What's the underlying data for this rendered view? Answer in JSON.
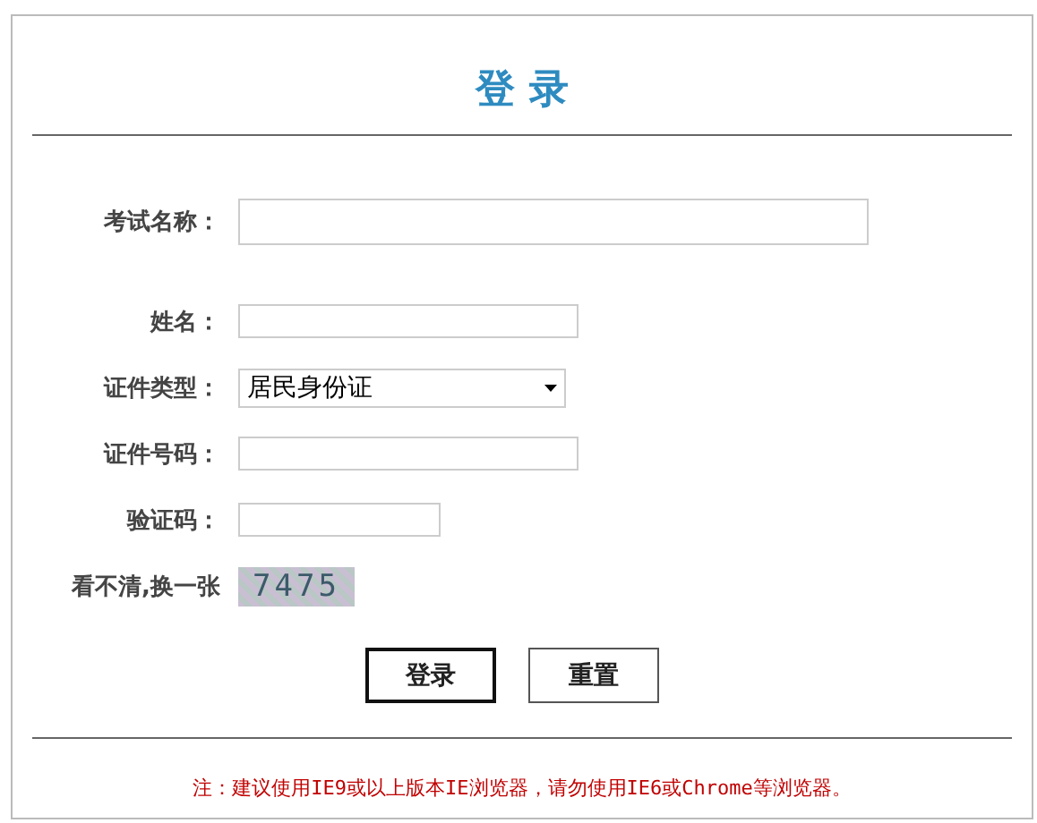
{
  "title": "登 录",
  "fields": [
    {
      "kind": "text",
      "label": "考试名称："
    },
    {
      "kind": "text",
      "label": "姓名："
    },
    {
      "kind": "select",
      "label": "证件类型：",
      "value": "居民身份证"
    },
    {
      "kind": "text",
      "label": "证件号码："
    },
    {
      "kind": "text",
      "label": "验证码："
    }
  ],
  "captcha": {
    "link": "看不清,换一张",
    "code": "7475"
  },
  "buttons": [
    "登录",
    "重置"
  ],
  "note": "注：建议使用IE9或以上版本IE浏览器，请勿使用IE6或Chrome等浏览器。"
}
